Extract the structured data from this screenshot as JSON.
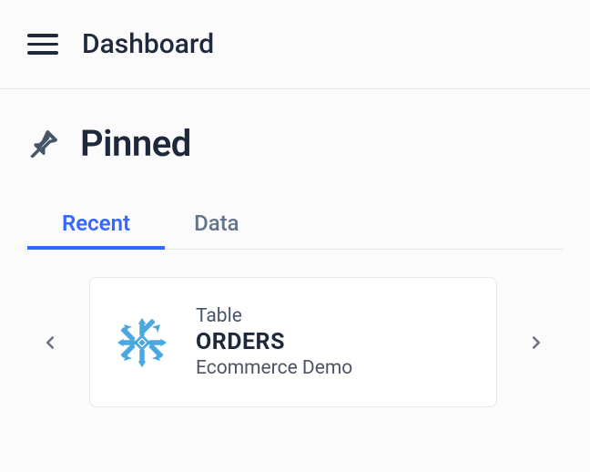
{
  "header": {
    "title": "Dashboard"
  },
  "section": {
    "title": "Pinned"
  },
  "tabs": [
    {
      "label": "Recent",
      "active": true
    },
    {
      "label": "Data",
      "active": false
    }
  ],
  "card": {
    "kind": "Table",
    "title": "ORDERS",
    "subtitle": "Ecommerce Demo",
    "icon_color": "#4aa8e0"
  }
}
